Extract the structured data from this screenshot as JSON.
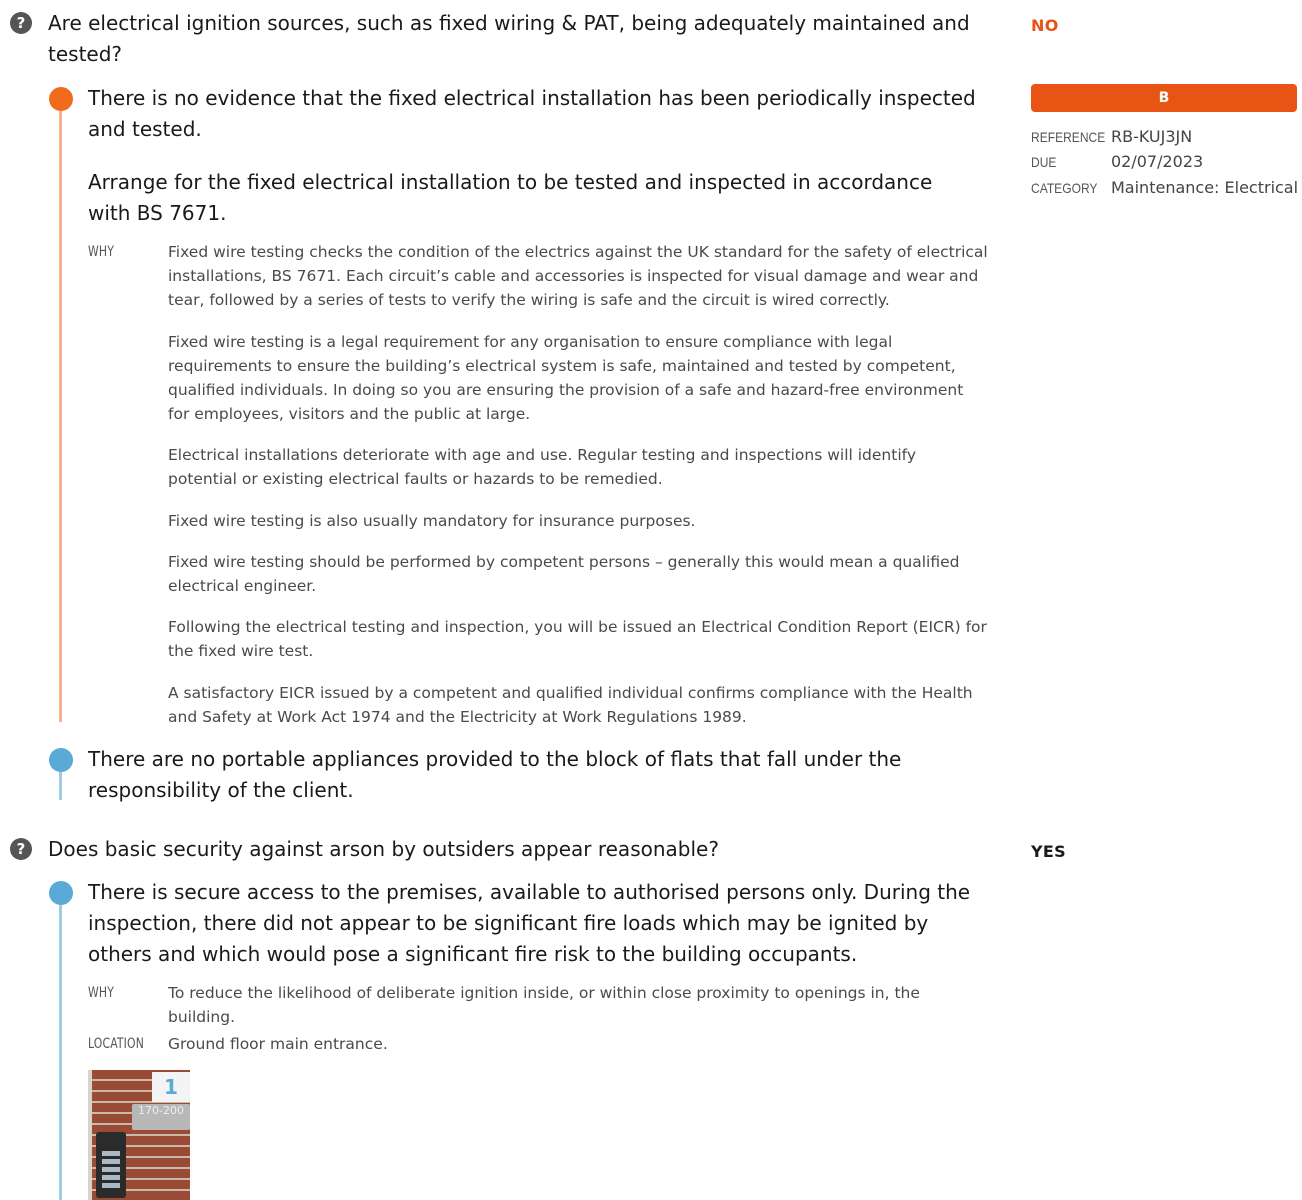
{
  "questions": [
    {
      "text": "Are electrical ignition sources, such as fixed wiring & PAT, being adequately maintained and tested?",
      "answer": "NO",
      "answer_color": "#e85414",
      "findings": [
        {
          "status_color": "#f26b1d",
          "observation": "There is no evidence that the fixed electrical installation has been periodically inspected and tested.",
          "action": "Arrange for the fixed electrical installation to be tested and inspected in accordance with BS 7671.",
          "why_label": "WHY",
          "why": [
            "Fixed wire testing checks the condition of the electrics against the UK standard for the safety of electrical installations, BS 7671. Each circuit’s cable and accessories is inspected for visual damage and wear and tear, followed by a series of tests to verify the wiring is safe and the circuit is wired correctly.",
            "Fixed wire testing is a legal requirement for any organisation to ensure compliance with legal requirements to ensure the building’s electrical system is safe, maintained and tested by competent, qualified individuals. In doing so you are ensuring the provision of a safe and hazard-free environment for employees, visitors and the public at large.",
            "Electrical installations deteriorate with age and use. Regular testing and inspections will identify potential or existing electrical faults or hazards to be remedied.",
            "Fixed wire testing is also usually mandatory for insurance purposes.",
            "Fixed wire testing should be performed by competent persons – generally this would mean a qualified electrical engineer.",
            "Following the electrical testing and inspection, you will be issued an Electrical Condition Report (EICR) for the fixed wire test.",
            "A satisfactory EICR issued by a competent and qualified individual confirms compliance with the Health and Safety at Work Act 1974 and the Electricity at Work Regulations 1989."
          ],
          "priority": "B",
          "reference_label": "REFERENCE",
          "reference": "RB-KUJ3JN",
          "due_label": "DUE",
          "due": "02/07/2023",
          "category_label": "CATEGORY",
          "category": "Maintenance: Electrical"
        },
        {
          "status_color": "#5aa9d6",
          "observation": "There are no portable appliances provided to the block of flats that fall under the responsibility of the client."
        }
      ]
    },
    {
      "text": "Does basic security against arson by outsiders appear reasonable?",
      "answer": "YES",
      "answer_color": "#1a1a1a",
      "findings": [
        {
          "status_color": "#5aa9d6",
          "observation": "There is secure access to the premises, available to authorised persons only. During the inspection, there did not appear to be significant fire loads which may be ignited by others and which would pose a significant fire risk to the building occupants.",
          "why_label": "WHY",
          "why": "To reduce the likelihood of deliberate ignition inside, or within close proximity to openings in, the building.",
          "location_label": "LOCATION",
          "location": "Ground floor main entrance.",
          "photo_number": "1",
          "photo_sign": "170-200"
        }
      ]
    }
  ],
  "help_icon": "question-circle-icon"
}
